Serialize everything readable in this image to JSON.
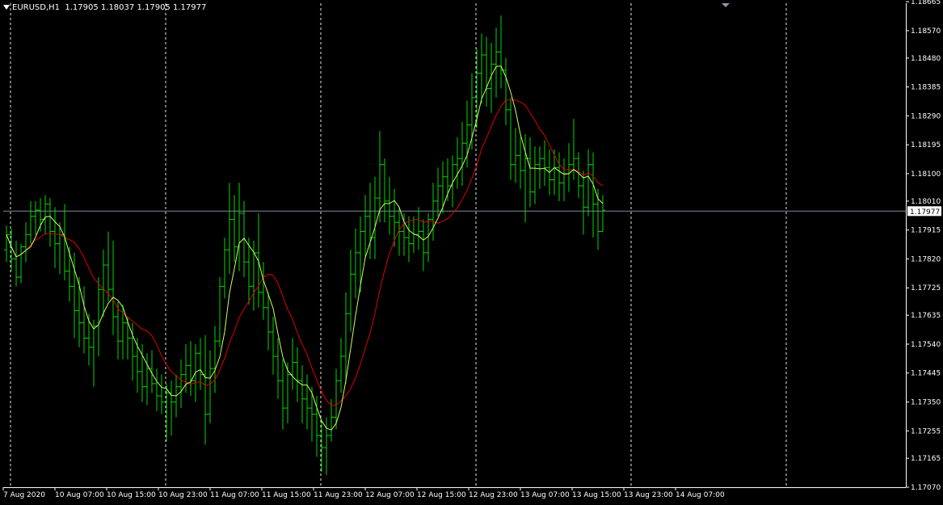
{
  "header": {
    "symbol": "EURUSD,H1",
    "ohlc": "1.17905 1.18037 1.17905 1.17977"
  },
  "colors": {
    "background": "#000000",
    "bar": "#00d900",
    "fast_ma": "#ccff66",
    "slow_ma": "#e00000",
    "grid": "#ffffff",
    "price_line": "#7a8a9a"
  },
  "chart_data": {
    "type": "bar",
    "ylim": [
      1.1707,
      1.1866
    ],
    "y_ticks": [
      "1.18665",
      "1.18570",
      "1.18480",
      "1.18385",
      "1.18290",
      "1.18195",
      "1.18100",
      "1.18010",
      "1.17915",
      "1.17820",
      "1.17725",
      "1.17635",
      "1.17540",
      "1.17445",
      "1.17350",
      "1.17255",
      "1.17165",
      "1.17070"
    ],
    "x_ticks": [
      "7 Aug 2020",
      "10 Aug 07:00",
      "10 Aug 15:00",
      "10 Aug 23:00",
      "11 Aug 07:00",
      "11 Aug 15:00",
      "11 Aug 23:00",
      "12 Aug 07:00",
      "12 Aug 15:00",
      "12 Aug 23:00",
      "13 Aug 07:00",
      "13 Aug 15:00",
      "13 Aug 23:00",
      "14 Aug 07:00"
    ],
    "current_price": "1.17977",
    "series": [
      {
        "values": [
          [
            1.1785,
            1.1793,
            1.1781,
            1.179
          ],
          [
            1.179,
            1.1792,
            1.1778,
            1.1782
          ],
          [
            1.1782,
            1.1788,
            1.1773,
            1.1776
          ],
          [
            1.1776,
            1.1787,
            1.1774,
            1.1786
          ],
          [
            1.1786,
            1.1794,
            1.1781,
            1.179
          ],
          [
            1.179,
            1.1801,
            1.1787,
            1.1796
          ],
          [
            1.1796,
            1.1801,
            1.179,
            1.1798
          ],
          [
            1.1798,
            1.1802,
            1.1791,
            1.1795
          ],
          [
            1.1795,
            1.1803,
            1.179,
            1.18
          ],
          [
            1.18,
            1.1802,
            1.1786,
            1.1791
          ],
          [
            1.1791,
            1.1799,
            1.1779,
            1.1787
          ],
          [
            1.1787,
            1.1794,
            1.1777,
            1.179
          ],
          [
            1.179,
            1.18,
            1.1775,
            1.1778
          ],
          [
            1.1778,
            1.1786,
            1.1768,
            1.1773
          ],
          [
            1.1773,
            1.1784,
            1.1756,
            1.1765
          ],
          [
            1.1765,
            1.1776,
            1.1753,
            1.1761
          ],
          [
            1.1761,
            1.1773,
            1.1751,
            1.1756
          ],
          [
            1.1756,
            1.1764,
            1.1747,
            1.1753
          ],
          [
            1.1753,
            1.1762,
            1.174,
            1.176
          ],
          [
            1.176,
            1.1776,
            1.175,
            1.1772
          ],
          [
            1.1772,
            1.1785,
            1.1763,
            1.178
          ],
          [
            1.178,
            1.1791,
            1.1768,
            1.1772
          ],
          [
            1.1772,
            1.1788,
            1.1757,
            1.1763
          ],
          [
            1.1763,
            1.1768,
            1.1749,
            1.1755
          ],
          [
            1.1755,
            1.1767,
            1.1749,
            1.1761
          ],
          [
            1.1761,
            1.1763,
            1.1749,
            1.1756
          ],
          [
            1.1756,
            1.1761,
            1.1742,
            1.175
          ],
          [
            1.175,
            1.1756,
            1.1738,
            1.1745
          ],
          [
            1.1745,
            1.1754,
            1.1735,
            1.174
          ],
          [
            1.174,
            1.1751,
            1.1734,
            1.1746
          ],
          [
            1.1746,
            1.1752,
            1.1738,
            1.1741
          ],
          [
            1.1741,
            1.1746,
            1.1732,
            1.1737
          ],
          [
            1.1737,
            1.1744,
            1.1731,
            1.1735
          ],
          [
            1.1735,
            1.1741,
            1.1722,
            1.1738
          ],
          [
            1.1738,
            1.1742,
            1.1724,
            1.1735
          ],
          [
            1.1735,
            1.1744,
            1.173,
            1.174
          ],
          [
            1.174,
            1.1749,
            1.1733,
            1.1744
          ],
          [
            1.1744,
            1.1754,
            1.1738,
            1.1747
          ],
          [
            1.1747,
            1.1755,
            1.1737,
            1.1742
          ],
          [
            1.1742,
            1.1754,
            1.1735,
            1.1751
          ],
          [
            1.1751,
            1.1756,
            1.1739,
            1.1744
          ],
          [
            1.1744,
            1.1757,
            1.1721,
            1.1731
          ],
          [
            1.1731,
            1.1752,
            1.1728,
            1.1746
          ],
          [
            1.1746,
            1.176,
            1.1738,
            1.1755
          ],
          [
            1.1755,
            1.1776,
            1.1753,
            1.1773
          ],
          [
            1.1773,
            1.1789,
            1.1769,
            1.1785
          ],
          [
            1.1785,
            1.1807,
            1.1777,
            1.1795
          ],
          [
            1.1795,
            1.1803,
            1.1781,
            1.1786
          ],
          [
            1.1786,
            1.1807,
            1.1778,
            1.1797
          ],
          [
            1.1797,
            1.1801,
            1.1776,
            1.1781
          ],
          [
            1.1781,
            1.1789,
            1.1767,
            1.1773
          ],
          [
            1.1773,
            1.1788,
            1.1765,
            1.1784
          ],
          [
            1.1784,
            1.1797,
            1.1766,
            1.1771
          ],
          [
            1.1771,
            1.1781,
            1.1762,
            1.1766
          ],
          [
            1.1766,
            1.1771,
            1.1752,
            1.1758
          ],
          [
            1.1758,
            1.1763,
            1.1744,
            1.175
          ],
          [
            1.175,
            1.1756,
            1.1736,
            1.1742
          ],
          [
            1.1742,
            1.1749,
            1.1726,
            1.1733
          ],
          [
            1.1733,
            1.1748,
            1.1728,
            1.1744
          ],
          [
            1.1744,
            1.1756,
            1.1739,
            1.1748
          ],
          [
            1.1748,
            1.1753,
            1.1735,
            1.1742
          ],
          [
            1.1742,
            1.1747,
            1.1728,
            1.1736
          ],
          [
            1.1736,
            1.1744,
            1.1726,
            1.1733
          ],
          [
            1.1733,
            1.174,
            1.1722,
            1.1731
          ],
          [
            1.1731,
            1.1737,
            1.1717,
            1.1724
          ],
          [
            1.1724,
            1.1729,
            1.1712,
            1.172
          ],
          [
            1.172,
            1.173,
            1.1711,
            1.1724
          ],
          [
            1.1724,
            1.1736,
            1.1722,
            1.173
          ],
          [
            1.173,
            1.1746,
            1.1726,
            1.1742
          ],
          [
            1.1742,
            1.1756,
            1.1738,
            1.175
          ],
          [
            1.175,
            1.1771,
            1.1741,
            1.1764
          ],
          [
            1.1764,
            1.1785,
            1.1758,
            1.1777
          ],
          [
            1.1777,
            1.1792,
            1.1769,
            1.1784
          ],
          [
            1.1784,
            1.1796,
            1.1771,
            1.1791
          ],
          [
            1.1791,
            1.1803,
            1.1782,
            1.1796
          ],
          [
            1.1796,
            1.1807,
            1.1782,
            1.1789
          ],
          [
            1.1789,
            1.1809,
            1.1782,
            1.1802
          ],
          [
            1.1802,
            1.1824,
            1.1794,
            1.1813
          ],
          [
            1.1813,
            1.1815,
            1.1794,
            1.1801
          ],
          [
            1.1801,
            1.1809,
            1.179,
            1.1796
          ],
          [
            1.1796,
            1.1805,
            1.1786,
            1.1794
          ],
          [
            1.1794,
            1.1799,
            1.1783,
            1.1791
          ],
          [
            1.1791,
            1.1797,
            1.1783,
            1.1789
          ],
          [
            1.1789,
            1.1796,
            1.1781,
            1.1787
          ],
          [
            1.1787,
            1.1796,
            1.1784,
            1.179
          ],
          [
            1.179,
            1.1799,
            1.1785,
            1.1791
          ],
          [
            1.1791,
            1.1795,
            1.1778,
            1.1784
          ],
          [
            1.1784,
            1.1797,
            1.1781,
            1.1795
          ],
          [
            1.1795,
            1.1807,
            1.1788,
            1.1801
          ],
          [
            1.1801,
            1.1812,
            1.1796,
            1.1806
          ],
          [
            1.1806,
            1.1814,
            1.1797,
            1.1809
          ],
          [
            1.1809,
            1.1815,
            1.1801,
            1.1806
          ],
          [
            1.1806,
            1.1816,
            1.1799,
            1.1813
          ],
          [
            1.1813,
            1.1822,
            1.1805,
            1.1815
          ],
          [
            1.1815,
            1.1827,
            1.1806,
            1.182
          ],
          [
            1.182,
            1.1834,
            1.1812,
            1.1826
          ],
          [
            1.1826,
            1.1843,
            1.1818,
            1.1835
          ],
          [
            1.1835,
            1.1851,
            1.1825,
            1.1843
          ],
          [
            1.1843,
            1.1856,
            1.1833,
            1.1849
          ],
          [
            1.1849,
            1.1855,
            1.1832,
            1.1838
          ],
          [
            1.1838,
            1.1853,
            1.183,
            1.1846
          ],
          [
            1.1846,
            1.1858,
            1.1835,
            1.185
          ],
          [
            1.185,
            1.1862,
            1.1838,
            1.1844
          ],
          [
            1.1844,
            1.1848,
            1.1826,
            1.1831
          ],
          [
            1.1831,
            1.1835,
            1.1808,
            1.1813
          ],
          [
            1.1813,
            1.1825,
            1.1807,
            1.1816
          ],
          [
            1.1816,
            1.1822,
            1.1805,
            1.1811
          ],
          [
            1.1811,
            1.1823,
            1.1794,
            1.1815
          ],
          [
            1.1815,
            1.1822,
            1.1799,
            1.1804
          ],
          [
            1.1804,
            1.1819,
            1.18,
            1.1813
          ],
          [
            1.1813,
            1.1819,
            1.1805,
            1.1815
          ],
          [
            1.1815,
            1.1821,
            1.1806,
            1.1812
          ],
          [
            1.1812,
            1.1818,
            1.1803,
            1.1808
          ],
          [
            1.1808,
            1.1818,
            1.1803,
            1.1812
          ],
          [
            1.1812,
            1.1817,
            1.1801,
            1.1807
          ],
          [
            1.1807,
            1.1815,
            1.1801,
            1.181
          ],
          [
            1.181,
            1.182,
            1.1804,
            1.1813
          ],
          [
            1.1813,
            1.1828,
            1.1808,
            1.1815
          ],
          [
            1.1815,
            1.1817,
            1.1802,
            1.1806
          ],
          [
            1.1806,
            1.1811,
            1.179,
            1.1799
          ],
          [
            1.1799,
            1.1818,
            1.1796,
            1.1813
          ],
          [
            1.1813,
            1.1817,
            1.1789,
            1.18
          ],
          [
            1.18,
            1.1805,
            1.1785,
            1.1791
          ],
          [
            1.1791,
            1.1803,
            1.1791,
            1.1798
          ]
        ]
      }
    ]
  }
}
